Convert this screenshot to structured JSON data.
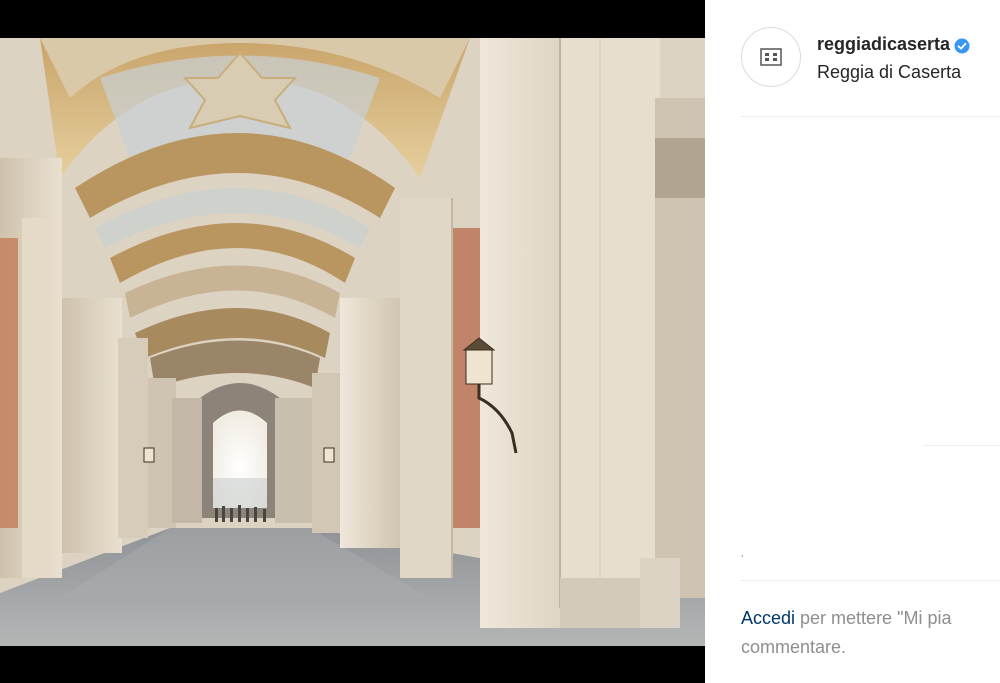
{
  "post": {
    "photo_alt": "Reggia di Caserta arcade",
    "account": {
      "username": "reggiadicaserta",
      "location": "Reggia di Caserta",
      "verified": true
    },
    "footer": {
      "login_link": "Accedi",
      "prompt_part1": " per mettere \"Mi pia",
      "prompt_part2": "commentare."
    },
    "speck": "ʼ"
  },
  "colors": {
    "verified_badge": "#3897f0",
    "login_link": "#00376b",
    "muted_text": "#8e8e8e"
  },
  "icons": {
    "avatar": "palace-logo-icon",
    "badge": "verified-badge-icon"
  }
}
